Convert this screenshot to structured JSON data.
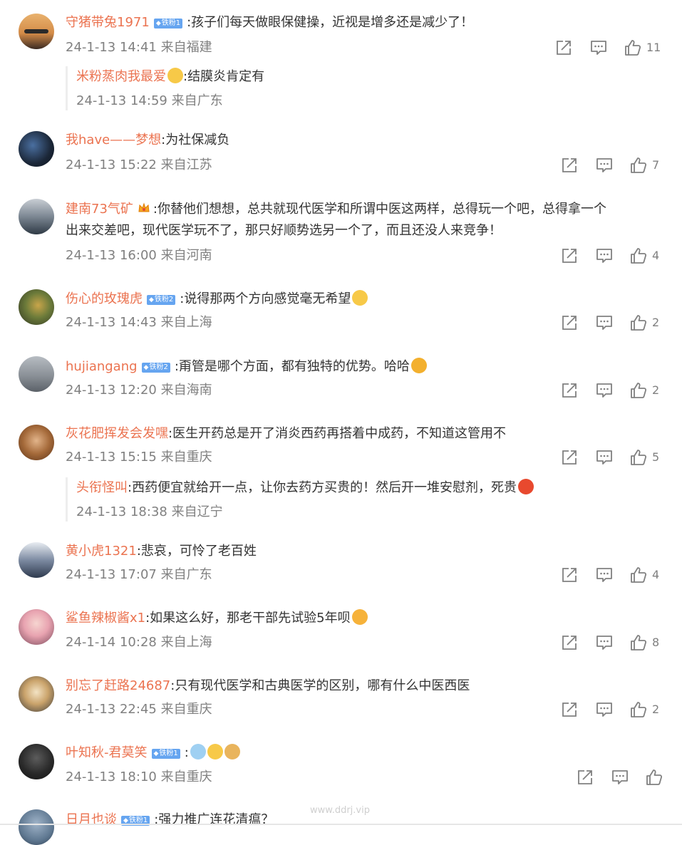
{
  "comments": [
    {
      "user": "守猪带兔1971",
      "badge": "铁粉1",
      "text": ":孩子们每天做眼保健操，近视是增多还是减少了！",
      "time": "24-1-13 14:41",
      "loc": "来自福建",
      "likes": "11",
      "reply": {
        "user": "米粉蒸肉我最爱",
        "text": ":结膜炎肯定有",
        "time": "24-1-13 14:59",
        "loc": "来自广东"
      }
    },
    {
      "user": "我have——梦想",
      "text": ":为社保减负",
      "time": "24-1-13 15:22",
      "loc": "来自江苏",
      "likes": "7"
    },
    {
      "user": "建南73气矿",
      "text": ":你替他们想想，总共就现代医学和所谓中医这两样，总得玩一个吧，总得拿一个",
      "text2": "出来交差吧，现代医学玩不了，那只好顺势选另一个了，而且还没人来竞争！",
      "time": "24-1-13 16:00",
      "loc": "来自河南",
      "likes": "4"
    },
    {
      "user": "伤心的玫瑰虎",
      "badge": "铁粉2",
      "text": ":说得那两个方向感觉毫无希望",
      "time": "24-1-13 14:43",
      "loc": "来自上海",
      "likes": "2"
    },
    {
      "user": "hujiangang",
      "badge": "铁粉2",
      "text": ":甭管是哪个方面，都有独特的优势。哈哈",
      "time": "24-1-13 12:20",
      "loc": "来自海南",
      "likes": "2"
    },
    {
      "user": "灰花肥挥发会发嘿",
      "text": ":医生开药总是开了消炎西药再搭着中成药，不知道这管用不",
      "time": "24-1-13 15:15",
      "loc": "来自重庆",
      "likes": "5",
      "reply": {
        "user": "头衔怪叫",
        "text": ":西药便宜就给开一点，让你去药方买贵的！然后开一堆安慰剂，死贵",
        "time": "24-1-13 18:38",
        "loc": "来自辽宁"
      }
    },
    {
      "user": "黄小虎1321",
      "text": ":悲哀，可怜了老百姓",
      "time": "24-1-13 17:07",
      "loc": "来自广东",
      "likes": "4"
    },
    {
      "user": "鲨鱼辣椒酱x1",
      "text": ":如果这么好，那老干部先试验5年呗",
      "time": "24-1-14 10:28",
      "loc": "来自上海",
      "likes": "8"
    },
    {
      "user": "别忘了赶路24687",
      "text": ":只有现代医学和古典医学的区别，哪有什么中医西医",
      "time": "24-1-13 22:45",
      "loc": "来自重庆",
      "likes": "2"
    },
    {
      "user": "叶知秋-君莫笑",
      "badge": "铁粉1",
      "text": ":",
      "time": "24-1-13 18:10",
      "loc": "来自重庆",
      "likes": ""
    },
    {
      "user": "日月也谈",
      "badge": "铁粉1",
      "text": ":强力推广连花清瘟？"
    }
  ],
  "watermark": "www.ddrj.vip",
  "colors": {
    "username": "#eb7350",
    "meta": "#808080",
    "badge": "#66a5f0",
    "text": "#333333"
  },
  "icons": {
    "share": "share-icon",
    "comment": "comment-icon",
    "like": "like-icon",
    "diamond": "diamond-icon",
    "crown": "crown-icon"
  }
}
